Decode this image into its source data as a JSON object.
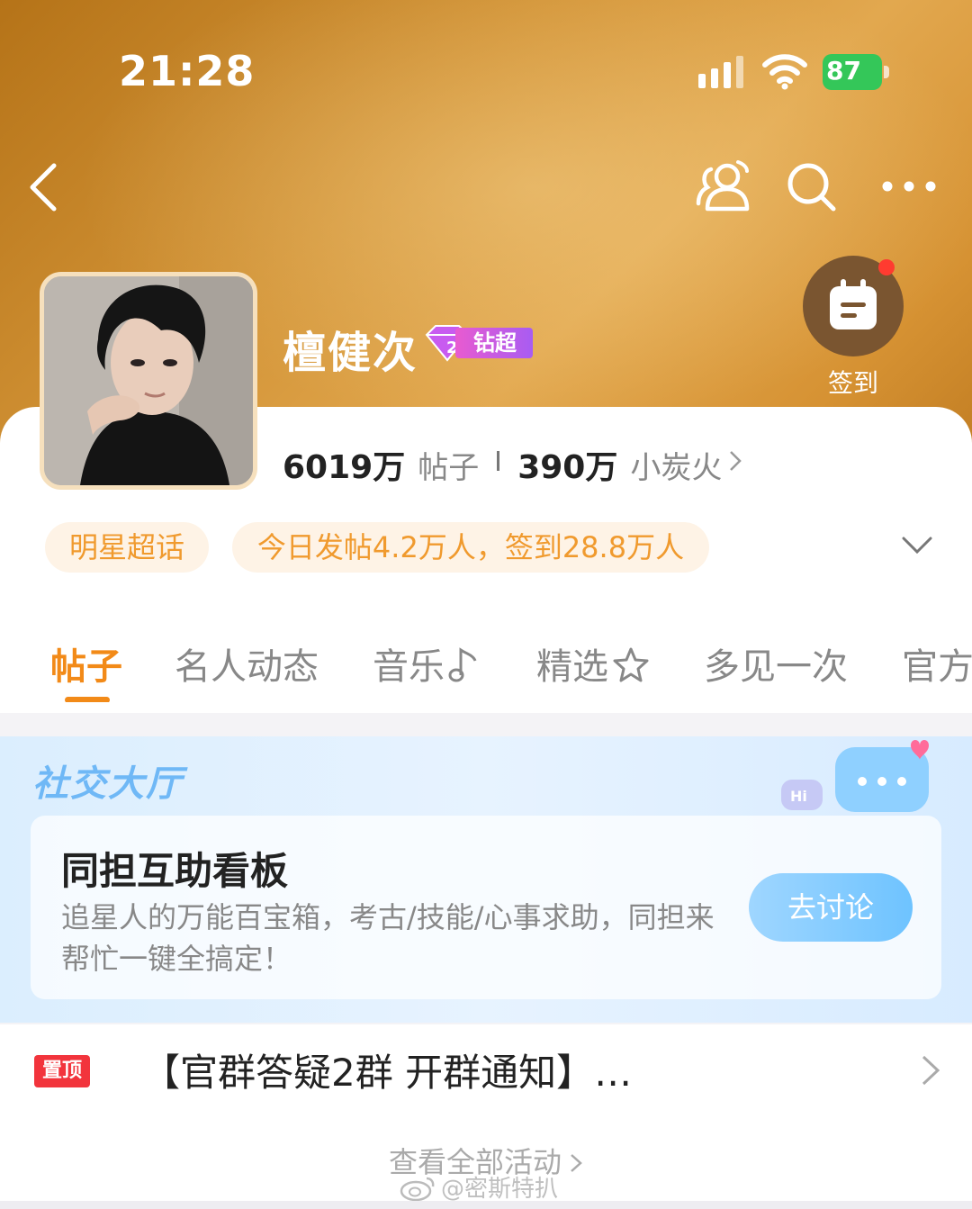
{
  "status_bar": {
    "time": "21:28",
    "battery": "87"
  },
  "topic": {
    "name": "檀健次",
    "badge_label": "钻超",
    "checkin_label": "签到"
  },
  "stats": {
    "posts_value": "6019万",
    "posts_label": "帖子",
    "fans_value": "390万",
    "fans_label": "小炭火"
  },
  "tags": {
    "category": "明星超话",
    "today": "今日发帖4.2万人，签到28.8万人"
  },
  "tabs": [
    {
      "label": "帖子",
      "active": true
    },
    {
      "label": "名人动态",
      "active": false
    },
    {
      "label": "音乐",
      "active": false
    },
    {
      "label": "精选",
      "active": false
    },
    {
      "label": "多见一次",
      "active": false
    },
    {
      "label": "官方",
      "active": false
    }
  ],
  "social_hall": {
    "title": "社交大厅",
    "card_title": "同担互助看板",
    "card_desc": "追星人的万能百宝箱，考古/技能/心事求助，同担来帮忙一键全搞定！",
    "button_label": "去讨论",
    "bubble_text": "Hi"
  },
  "pinned": {
    "badge": "置顶",
    "title": "【官群答疑2群 开群通知】…"
  },
  "view_all": "查看全部活动",
  "watermark": "@密斯特扒",
  "colors": {
    "accent": "#f28a18",
    "header": "#d39437",
    "pinned_red": "#f2343c"
  }
}
